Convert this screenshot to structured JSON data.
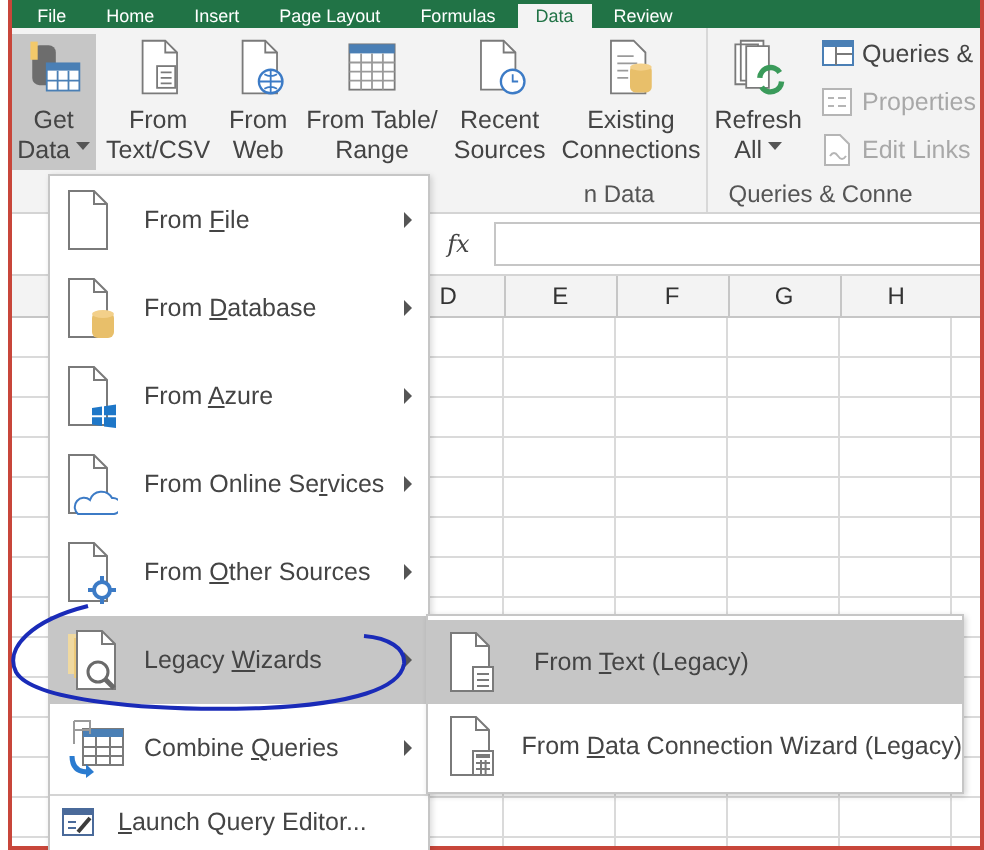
{
  "tabs": [
    {
      "label": "File",
      "selected": false
    },
    {
      "label": "Home",
      "selected": false
    },
    {
      "label": "Insert",
      "selected": false
    },
    {
      "label": "Page Layout",
      "selected": false
    },
    {
      "label": "Formulas",
      "selected": false
    },
    {
      "label": "Data",
      "selected": true
    },
    {
      "label": "Review",
      "selected": false
    }
  ],
  "ribbon": {
    "groups": [
      {
        "label": "n Data",
        "large_buttons": [
          {
            "kind": "get-data",
            "label_lines": [
              "Get",
              "Data"
            ],
            "has_menu": true,
            "pressed": true
          },
          {
            "kind": "text-file",
            "label_lines": [
              "From",
              "Text/CSV"
            ],
            "has_menu": false,
            "pressed": false
          },
          {
            "kind": "web-file",
            "label_lines": [
              "From",
              "Web"
            ],
            "has_menu": false,
            "pressed": false
          },
          {
            "kind": "table",
            "label_lines": [
              "From Table/",
              "Range"
            ],
            "has_menu": false,
            "pressed": false
          },
          {
            "kind": "recent-file",
            "label_lines": [
              "Recent",
              "Sources"
            ],
            "has_menu": false,
            "pressed": false
          },
          {
            "kind": "connections",
            "label_lines": [
              "Existing",
              "Connections"
            ],
            "has_menu": false,
            "pressed": false
          }
        ]
      },
      {
        "label": "Queries & Conne",
        "large_buttons": [
          {
            "kind": "refresh",
            "label_lines": [
              "Refresh",
              "All"
            ],
            "has_menu": true,
            "pressed": false
          }
        ],
        "small_buttons": [
          {
            "kind": "queries",
            "label": "Queries &",
            "disabled": false
          },
          {
            "kind": "properties",
            "label": "Properties",
            "disabled": true
          },
          {
            "kind": "links",
            "label": "Edit Links",
            "disabled": true
          }
        ]
      }
    ]
  },
  "formula_bar": {
    "function_label": "fx"
  },
  "columns": [
    "D",
    "E",
    "F",
    "G",
    "H"
  ],
  "menu": {
    "items": [
      {
        "kind": "submenu",
        "label": {
          "pre": "From ",
          "key": "F",
          "post": "ile"
        },
        "selected": false
      },
      {
        "kind": "submenu",
        "label": {
          "pre": "From ",
          "key": "D",
          "post": "atabase"
        },
        "selected": false
      },
      {
        "kind": "submenu",
        "label": {
          "pre": "From ",
          "key": "A",
          "post": "zure"
        },
        "selected": false
      },
      {
        "kind": "submenu",
        "label": {
          "pre": "From Online Se",
          "key": "r",
          "post": "vices"
        },
        "selected": false
      },
      {
        "kind": "submenu",
        "label": {
          "pre": "From ",
          "key": "O",
          "post": "ther Sources"
        },
        "selected": false
      },
      {
        "kind": "submenu",
        "label": {
          "pre": "Legacy ",
          "key": "W",
          "post": "izards"
        },
        "selected": true
      },
      {
        "kind": "submenu",
        "label": {
          "pre": "Combine ",
          "key": "Q",
          "post": "ueries"
        },
        "selected": false
      },
      {
        "kind": "command",
        "label": {
          "key": "L",
          "post": "aunch Query Editor..."
        },
        "selected": false
      }
    ]
  },
  "submenu": {
    "items": [
      {
        "label": {
          "pre": "From ",
          "key": "T",
          "post": "ext (Legacy)"
        },
        "selected": true
      },
      {
        "label": {
          "pre": "From ",
          "key": "D",
          "post": "ata Connection Wizard (Legacy)"
        },
        "selected": false
      }
    ]
  }
}
